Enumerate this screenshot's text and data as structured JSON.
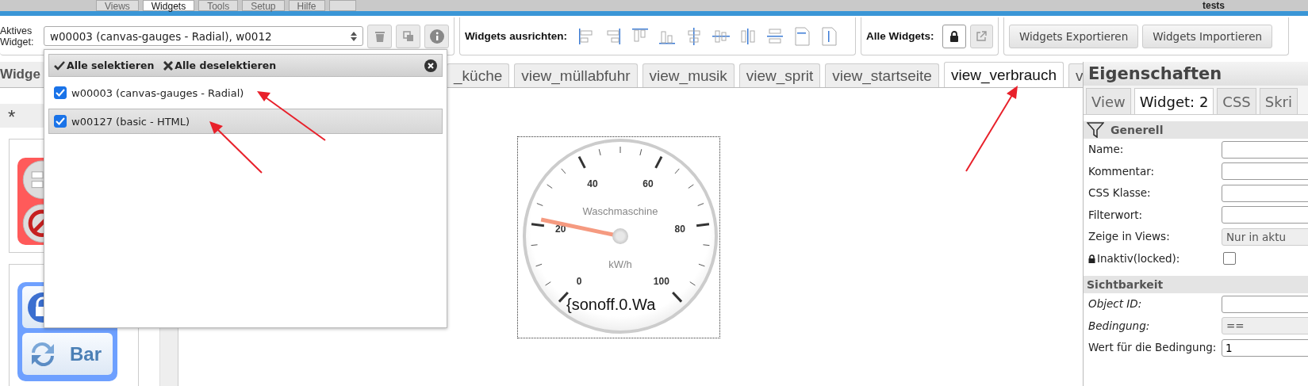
{
  "menu_tabs": [
    {
      "label": "Views",
      "selected": false
    },
    {
      "label": "Widgets",
      "selected": true
    },
    {
      "label": "Tools",
      "selected": false
    },
    {
      "label": "Setup",
      "selected": false
    },
    {
      "label": "Hilfe",
      "selected": false
    }
  ],
  "project_title": "tests",
  "toolbar": {
    "active_widget_label": "Aktives Widget:",
    "active_widget_value": "w00003 (canvas-gauges - Radial), w0012",
    "align_label": "Widgets ausrichten:",
    "all_widgets_label": "Alle Widgets:",
    "buttons": [
      "Widgets Exportieren",
      "Widgets Importieren"
    ]
  },
  "widget_panel": {
    "title": "Widge",
    "filter": "*",
    "palette_button": "Bar"
  },
  "view_tabs": [
    {
      "label": "_küche",
      "selected": false
    },
    {
      "label": "view_müllabfuhr",
      "selected": false
    },
    {
      "label": "view_musik",
      "selected": false
    },
    {
      "label": "view_sprit",
      "selected": false
    },
    {
      "label": "view_startseite",
      "selected": false
    },
    {
      "label": "view_verbrauch",
      "selected": true
    },
    {
      "label": "v",
      "selected": false
    }
  ],
  "widget_dropdown": {
    "select_all": "Alle selektieren",
    "deselect_all": "Alle deselektieren",
    "items": [
      {
        "label": "w00003 (canvas-gauges - Radial)",
        "checked": true,
        "selected": false
      },
      {
        "label": "w00127 (basic - HTML)",
        "checked": true,
        "selected": true
      }
    ]
  },
  "gauge": {
    "title": "Waschmaschine",
    "units": "kW/h",
    "value_text": "{sonoff.0.Wa",
    "level": 0.215,
    "scale_labels": [
      "0",
      "20",
      "40",
      "60",
      "80",
      "100"
    ]
  },
  "properties": {
    "title": "Eigenschaften",
    "tabs": [
      {
        "label": "View",
        "selected": false
      },
      {
        "label": "Widget: 2",
        "selected": true
      },
      {
        "label": "CSS",
        "selected": false
      },
      {
        "label": "Skri",
        "selected": false
      }
    ],
    "sections": [
      {
        "title": "Generell",
        "filter_icon": true,
        "rows": [
          {
            "label": "Name:",
            "kind": "input"
          },
          {
            "label": "Kommentar:",
            "kind": "input"
          },
          {
            "label": "CSS Klasse:",
            "kind": "input"
          },
          {
            "label": "Filterwort:",
            "kind": "input"
          },
          {
            "label": "Zeige in Views:",
            "kind": "select",
            "value": "Nur in aktu"
          },
          {
            "label": "Inaktiv(locked):",
            "kind": "lock-checkbox",
            "checked": false
          }
        ]
      },
      {
        "title": "Sichtbarkeit",
        "filter_icon": false,
        "rows": [
          {
            "label": "Object ID:",
            "kind": "input",
            "italic": true
          },
          {
            "label": "Bedingung:",
            "kind": "select",
            "value": "==",
            "italic": true
          },
          {
            "label": "Wert für die Bedingung:",
            "kind": "input",
            "value": "1"
          }
        ]
      }
    ]
  }
}
